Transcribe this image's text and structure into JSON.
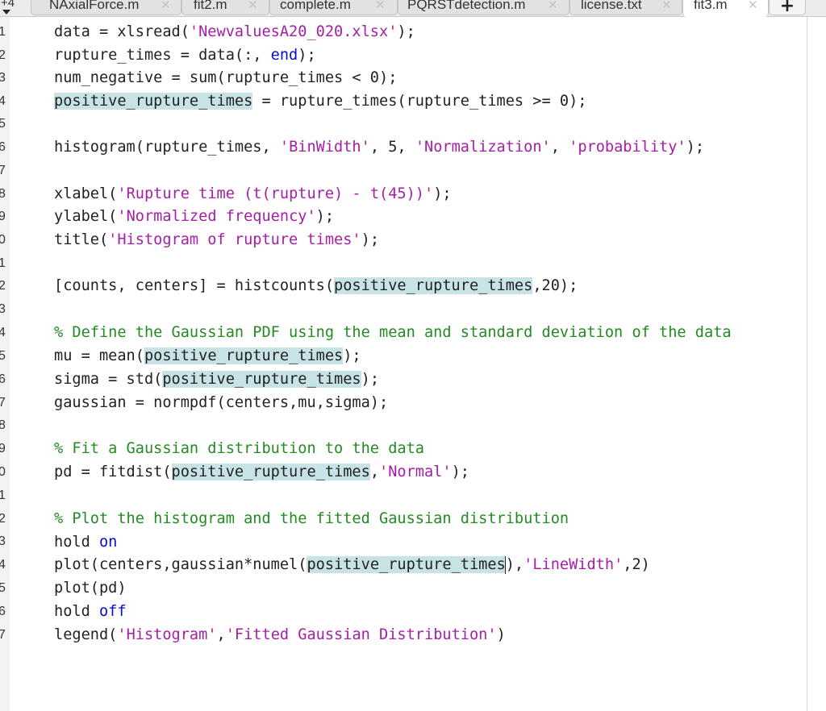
{
  "tabs": {
    "overflow_label": "+4",
    "items": [
      {
        "label": "NAxialForce.m"
      },
      {
        "label": "fit2.m"
      },
      {
        "label": "complete.m"
      },
      {
        "label": "PQRSTdetection.m"
      },
      {
        "label": "license.txt"
      },
      {
        "label": "fit3.m",
        "active": true
      }
    ],
    "close_glyph": "✕",
    "add_glyph": "+"
  },
  "gutter": {
    "line_numbers": [
      "1",
      "2",
      "3",
      "4",
      "5",
      "6",
      "7",
      "8",
      "9",
      "0",
      "1",
      "2",
      "3",
      "4",
      "5",
      "6",
      "7",
      "8",
      "9",
      "0",
      "1",
      "2",
      "3",
      "4",
      "5",
      "6",
      "7"
    ],
    "breakpoint_marker": "–"
  },
  "code": {
    "l1": {
      "a": "data = xlsread(",
      "s": "'NewvaluesA20_020.xlsx'",
      "b": ");"
    },
    "l2": {
      "a": "rupture_times = data(:, ",
      "k": "end",
      "b": ");"
    },
    "l3": {
      "a": "num_negative = sum(rupture_times < 0);"
    },
    "l4": {
      "h": "positive_rupture_times",
      "a": " = rupture_times(rupture_times >= 0);"
    },
    "l6": {
      "a": "histogram(rupture_times, ",
      "s1": "'BinWidth'",
      "m": ", 5, ",
      "s2": "'Normalization'",
      "c": ", ",
      "s3": "'probability'",
      "b": ");"
    },
    "l8": {
      "a": "xlabel(",
      "s": "'Rupture time (t(rupture) - t(45))'",
      "b": ");"
    },
    "l9": {
      "a": "ylabel(",
      "s": "'Normalized frequency'",
      "b": ");"
    },
    "l10": {
      "a": "title(",
      "s": "'Histogram of rupture times'",
      "b": ");"
    },
    "l12": {
      "a": "[counts, centers] = histcounts(",
      "h": "positive_rupture_times",
      "b": ",20);"
    },
    "l14": {
      "c": "% Define the Gaussian PDF using the mean and standard deviation of the data"
    },
    "l15": {
      "a": "mu = mean(",
      "h": "positive_rupture_times",
      "b": ");"
    },
    "l16": {
      "a": "sigma = std(",
      "h": "positive_rupture_times",
      "b": ");"
    },
    "l17": {
      "a": "gaussian = normpdf(centers,mu,sigma);"
    },
    "l19": {
      "c": "% Fit a Gaussian distribution to the data"
    },
    "l20": {
      "a": "pd = fitdist(",
      "h": "positive_rupture_times",
      "m": ",",
      "s": "'Normal'",
      "b": ");"
    },
    "l22": {
      "c": "% Plot the histogram and the fitted Gaussian distribution"
    },
    "l23": {
      "a": "hold ",
      "k": "on"
    },
    "l24": {
      "a": "plot(centers,gaussian*numel(",
      "h": "positive_rupture_times",
      "m": "),",
      "s1": "'LineWidth'",
      "b": ",2)"
    },
    "l25": {
      "a": "plot(pd)"
    },
    "l26": {
      "a": "hold ",
      "k": "off"
    },
    "l27": {
      "a": "legend(",
      "s1": "'Histogram'",
      "m": ",",
      "s2": "'Fitted Gaussian Distribution'",
      "b": ")"
    }
  }
}
